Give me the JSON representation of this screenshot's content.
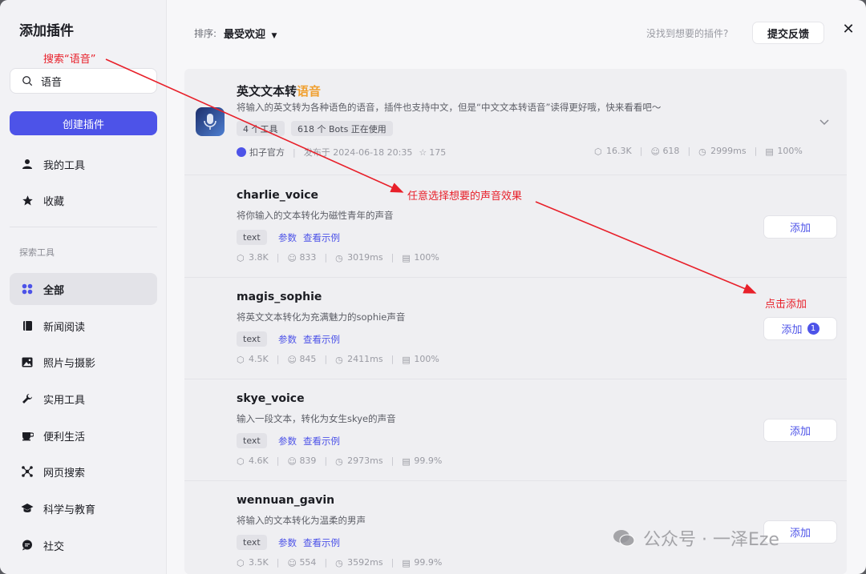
{
  "sidebar": {
    "title": "添加插件",
    "search_value": "语音",
    "create_label": "创建插件",
    "my_items": [
      {
        "label": "我的工具",
        "icon": "person-icon"
      },
      {
        "label": "收藏",
        "icon": "star-icon"
      }
    ],
    "section_label": "探索工具",
    "categories": [
      {
        "label": "全部",
        "icon": "grid-icon",
        "active": true
      },
      {
        "label": "新闻阅读",
        "icon": "book-icon"
      },
      {
        "label": "照片与摄影",
        "icon": "image-icon"
      },
      {
        "label": "实用工具",
        "icon": "wrench-icon"
      },
      {
        "label": "便利生活",
        "icon": "cup-icon"
      },
      {
        "label": "网页搜索",
        "icon": "network-icon"
      },
      {
        "label": "科学与教育",
        "icon": "graduation-cap-icon"
      },
      {
        "label": "社交",
        "icon": "chat-icon"
      }
    ]
  },
  "header": {
    "sort_label": "排序:",
    "sort_value": "最受欢迎",
    "hint": "没找到想要的插件?",
    "feedback_label": "提交反馈",
    "close": "✕"
  },
  "plugin": {
    "name_prefix": "英文文本转",
    "name_highlight": "语音",
    "description": "将输入的英文转为各种语色的语音，插件也支持中文，但是“中文文本转语音”读得更好哦，快来看看吧～",
    "tool_count": "4 个工具",
    "bots_using": "618 个 Bots 正在使用",
    "publisher": "扣子官方",
    "published": "发布于 2024-06-18 20:35",
    "stars": "175",
    "calls": "16.3K",
    "bots": "618",
    "latency": "2999ms",
    "success": "100%"
  },
  "tools": [
    {
      "name": "charlie_voice",
      "desc": "将你输入的文本转化为磁性青年的声音",
      "tag": "text",
      "params": "参数",
      "example": "查看示例",
      "calls": "3.8K",
      "bots": "833",
      "latency": "3019ms",
      "success": "100%",
      "add": "添加",
      "badge": ""
    },
    {
      "name": "magis_sophie",
      "desc": "将英文文本转化为充满魅力的sophie声音",
      "tag": "text",
      "params": "参数",
      "example": "查看示例",
      "calls": "4.5K",
      "bots": "845",
      "latency": "2411ms",
      "success": "100%",
      "add": "添加",
      "badge": "1"
    },
    {
      "name": "skye_voice",
      "desc": "输入一段文本，转化为女生skye的声音",
      "tag": "text",
      "params": "参数",
      "example": "查看示例",
      "calls": "4.6K",
      "bots": "839",
      "latency": "2973ms",
      "success": "99.9%",
      "add": "添加",
      "badge": ""
    },
    {
      "name": "wennuan_gavin",
      "desc": "将输入的文本转化为温柔的男声",
      "tag": "text",
      "params": "参数",
      "example": "查看示例",
      "calls": "3.5K",
      "bots": "554",
      "latency": "3592ms",
      "success": "99.9%",
      "add": "添加",
      "badge": ""
    }
  ],
  "annotations": {
    "search": "搜索“语音”",
    "choose": "任意选择想要的声音效果",
    "click_add": "点击添加",
    "color": "#e8202a"
  },
  "watermark": "公众号 · 一泽Eze"
}
